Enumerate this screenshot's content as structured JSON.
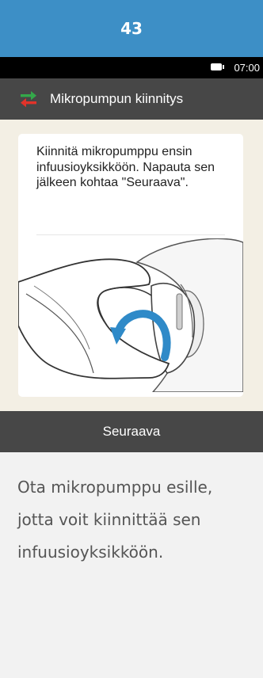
{
  "step_number": "43",
  "status_bar": {
    "time": "07:00",
    "battery_icon": "battery-icon"
  },
  "header": {
    "title": "Mikropumpun kiinnitys",
    "icon": "swap-arrows-icon",
    "icon_colors": {
      "top": "#34a84a",
      "bottom": "#e2332a"
    }
  },
  "card": {
    "instruction": "Kiinnitä mikropumppu ensin infuusioyksikköön. Napauta sen jälkeen kohtaa \"Seuraava\".",
    "illustration": "hand-attaching-micropump-illustration"
  },
  "buttons": {
    "next_label": "Seuraava"
  },
  "explanation": "Ota mikropumppu esille, jotta voit kiinnittää sen infuusioyksikköön.",
  "colors": {
    "step_header_bg": "#3d8fc6",
    "device_bg": "#f3efe4",
    "bar_bg": "#474747",
    "rotate_arrow": "#2f8ac8"
  }
}
